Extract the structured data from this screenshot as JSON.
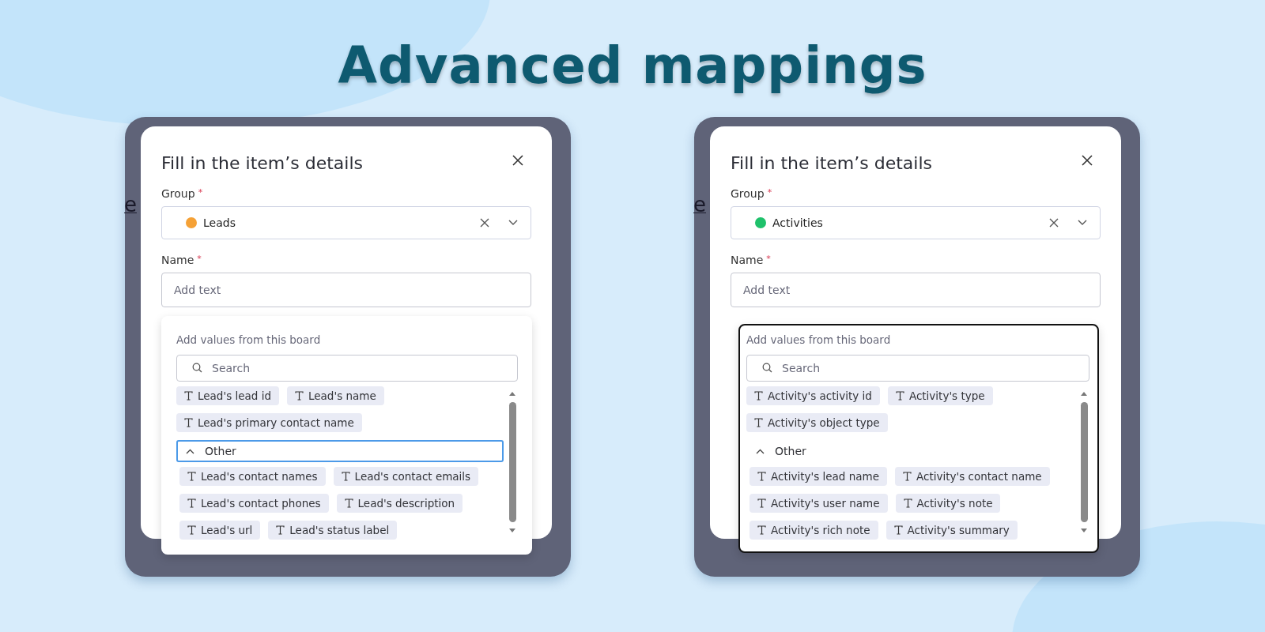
{
  "title": "Advanced mappings",
  "panels": [
    {
      "fragment": "e",
      "dialog_title": "Fill in the item’s details",
      "group_label": "Group",
      "group_required": "*",
      "group_value": {
        "label": "Leads",
        "color": "#f5a136"
      },
      "name_label": "Name",
      "name_required": "*",
      "name_placeholder": "Add text",
      "popover": {
        "focused": false,
        "heading": "Add values from this board",
        "search_placeholder": "Search",
        "top_chips": [
          "Lead's lead id",
          "Lead's name",
          "Lead's primary contact name"
        ],
        "section": {
          "label": "Other",
          "expanded": true,
          "focused": true
        },
        "chips": [
          "Lead's contact names",
          "Lead's contact emails",
          "Lead's contact phones",
          "Lead's description",
          "Lead's url",
          "Lead's status label"
        ]
      }
    },
    {
      "fragment": "e",
      "dialog_title": "Fill in the item’s details",
      "group_label": "Group",
      "group_required": "*",
      "group_value": {
        "label": "Activities",
        "color": "#1fc16b"
      },
      "name_label": "Name",
      "name_required": "*",
      "name_placeholder": "Add text",
      "popover": {
        "focused": true,
        "heading": "Add values from this board",
        "search_placeholder": "Search",
        "top_chips": [
          "Activity's activity id",
          "Activity's type",
          "Activity's object type"
        ],
        "section": {
          "label": "Other",
          "expanded": true,
          "focused": false
        },
        "chips": [
          "Activity's lead name",
          "Activity's contact name",
          "Activity's user name",
          "Activity's note",
          "Activity's rich note",
          "Activity's summary"
        ]
      }
    }
  ]
}
